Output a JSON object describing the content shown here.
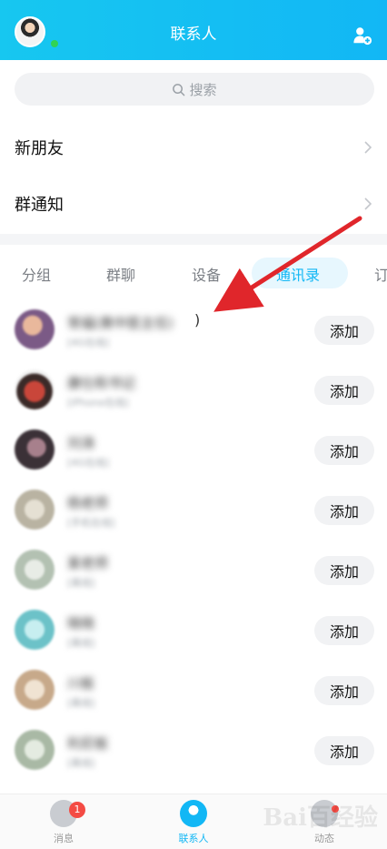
{
  "header": {
    "title": "联系人"
  },
  "search": {
    "placeholder": "搜索"
  },
  "links": [
    {
      "label": "新朋友"
    },
    {
      "label": "群通知"
    }
  ],
  "tabs": [
    {
      "label": "分组"
    },
    {
      "label": "群聊"
    },
    {
      "label": "设备"
    },
    {
      "label": "通讯录",
      "active": true
    },
    {
      "label": "订"
    }
  ],
  "contacts": [
    {
      "name": "常福(黄中医主任)",
      "status": "[4G在线]",
      "suffix": ")",
      "action": "添加",
      "avatar_color": "#8a6a8f"
    },
    {
      "name": "康仕和书记",
      "status": "[iPhone在线]",
      "action": "添加",
      "avatar_color": "#b35b4a"
    },
    {
      "name": "刘涛",
      "status": "[4G在线]",
      "action": "添加",
      "avatar_color": "#5b4f57"
    },
    {
      "name": "杨老师",
      "status": "[手机在线]",
      "action": "添加",
      "avatar_color": "#c9c4b3"
    },
    {
      "name": "某老师",
      "status": "[离线]",
      "action": "添加",
      "avatar_color": "#cfd8cf"
    },
    {
      "name": "晓晓",
      "status": "[离线]",
      "action": "添加",
      "avatar_color": "#8fd3d6"
    },
    {
      "name": "川板",
      "status": "[离线]",
      "action": "添加",
      "avatar_color": "#d9c2a8"
    },
    {
      "name": "利尼板",
      "status": "[离线]",
      "action": "添加",
      "avatar_color": "#b8c7b4"
    }
  ],
  "bottom_tabs": [
    {
      "label": "消息",
      "badge": "1"
    },
    {
      "label": "联系人",
      "active": true
    },
    {
      "label": "动态"
    }
  ],
  "watermark": {
    "text": "Bai百经验"
  },
  "colors": {
    "accent": "#12b7f5",
    "annotation": "#e0262b",
    "badge": "#f44b44"
  }
}
